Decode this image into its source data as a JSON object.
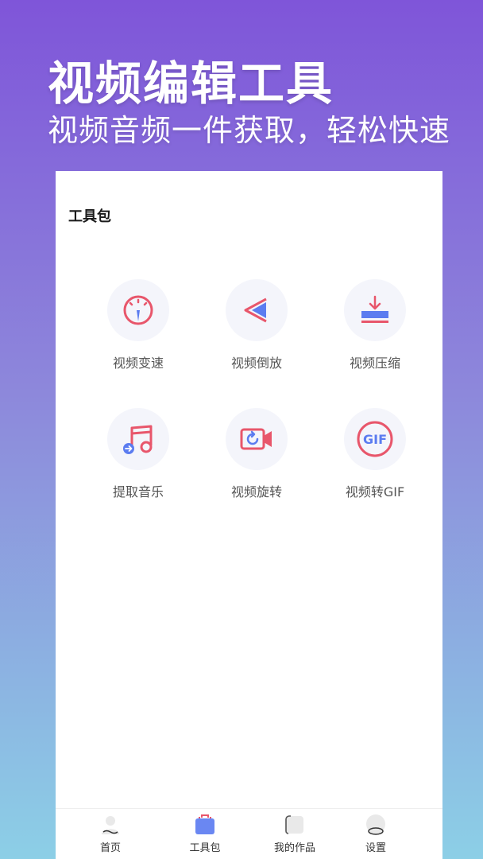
{
  "promo": {
    "headline": "视频编辑工具",
    "subline": "视频音频一件获取，轻松快速"
  },
  "section_title": "工具包",
  "tools": [
    {
      "label": "视频变速",
      "icon": "speedometer-icon"
    },
    {
      "label": "视频倒放",
      "icon": "reverse-icon"
    },
    {
      "label": "视频压缩",
      "icon": "compress-icon"
    },
    {
      "label": "提取音乐",
      "icon": "music-extract-icon"
    },
    {
      "label": "视频旋转",
      "icon": "rotate-video-icon"
    },
    {
      "label": "视频转GIF",
      "icon": "gif-icon"
    }
  ],
  "tabbar": {
    "items": [
      {
        "label": "首页",
        "icon": "home-person-icon"
      },
      {
        "label": "工具包",
        "icon": "toolbox-icon",
        "active": true
      },
      {
        "label": "我的作品",
        "icon": "works-icon"
      },
      {
        "label": "设置",
        "icon": "settings-icon"
      }
    ]
  },
  "colors": {
    "accent_red": "#e8566b",
    "accent_blue": "#5b7cf0",
    "icon_bg": "#f4f5fb"
  }
}
